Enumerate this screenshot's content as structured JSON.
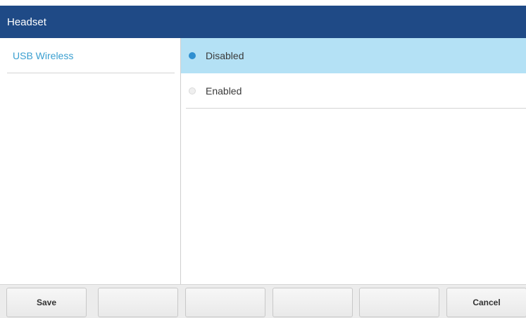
{
  "titlebar": {
    "title": "Headset"
  },
  "sidebar": {
    "items": [
      {
        "label": "USB Wireless"
      }
    ]
  },
  "options": {
    "items": [
      {
        "label": "Disabled",
        "selected": true
      },
      {
        "label": "Enabled",
        "selected": false
      }
    ]
  },
  "softkeys": {
    "keys": [
      {
        "label": "Save"
      },
      {
        "label": ""
      },
      {
        "label": ""
      },
      {
        "label": ""
      },
      {
        "label": ""
      },
      {
        "label": "Cancel"
      }
    ]
  },
  "colors": {
    "titlebar_bg": "#1f4a86",
    "accent": "#3a9fd0",
    "selected_bg": "#b4e1f5"
  }
}
